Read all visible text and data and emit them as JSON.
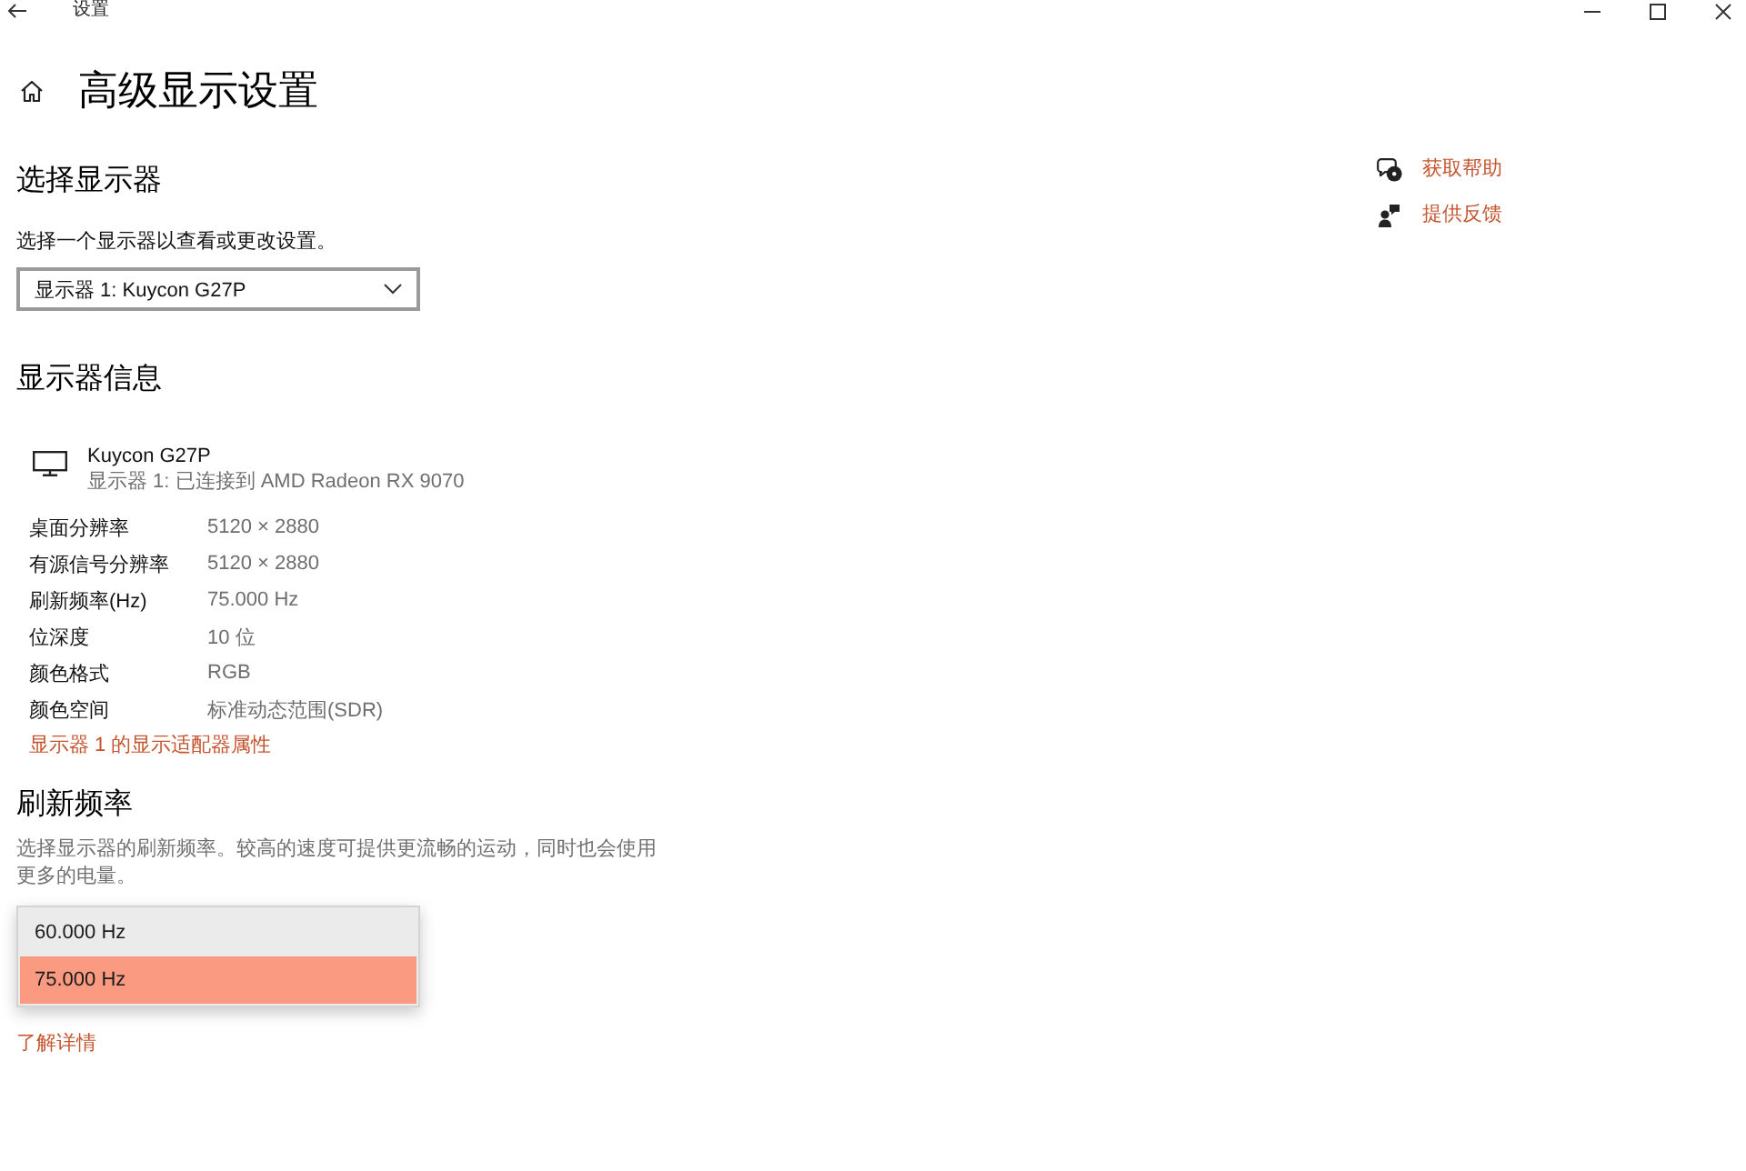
{
  "window": {
    "title": "设置"
  },
  "page": {
    "title": "高级显示设置"
  },
  "select_display": {
    "heading": "选择显示器",
    "description": "选择一个显示器以查看或更改设置。",
    "dropdown": {
      "value": "显示器 1: Kuycon G27P"
    }
  },
  "display_info": {
    "heading": "显示器信息",
    "monitor": {
      "name": "Kuycon G27P",
      "connection": "显示器 1: 已连接到 AMD Radeon RX 9070"
    },
    "properties": [
      {
        "label": "桌面分辨率",
        "value": "5120 × 2880"
      },
      {
        "label": "有源信号分辨率",
        "value": "5120 × 2880"
      },
      {
        "label": "刷新频率(Hz)",
        "value": "75.000 Hz"
      },
      {
        "label": "位深度",
        "value": "10 位"
      },
      {
        "label": "颜色格式",
        "value": "RGB"
      },
      {
        "label": "颜色空间",
        "value": "标准动态范围(SDR)"
      }
    ],
    "adapter_link": "显示器 1 的显示适配器属性"
  },
  "refresh_rate": {
    "heading": "刷新频率",
    "description": "选择显示器的刷新频率。较高的速度可提供更流畅的运动，同时也会使用更多的电量。",
    "options": [
      {
        "label": "60.000 Hz",
        "selected": false
      },
      {
        "label": "75.000 Hz",
        "selected": true
      }
    ],
    "learn_more_link": "了解详情"
  },
  "help_links": [
    {
      "kind": "help",
      "label": "获取帮助"
    },
    {
      "kind": "feedback",
      "label": "提供反馈"
    }
  ]
}
